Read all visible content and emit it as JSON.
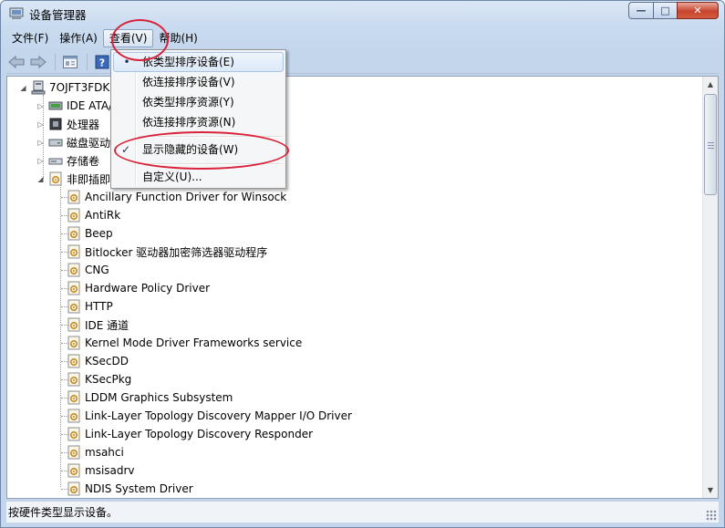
{
  "window": {
    "title": "设备管理器",
    "min_label": "—",
    "max_label": "□",
    "close_label": "✕"
  },
  "menubar": {
    "items": [
      "文件(F)",
      "操作(A)",
      "查看(V)",
      "帮助(H)"
    ],
    "active_index": 2
  },
  "toolbar": {
    "icons": [
      "back-arrow-icon",
      "forward-arrow-icon",
      "properties-icon",
      "help-icon"
    ]
  },
  "tree": {
    "root": "7OJFT3FDKI",
    "categories": [
      {
        "label": "IDE ATA/",
        "icon": "ide-controller-icon"
      },
      {
        "label": "处理器",
        "icon": "processor-icon"
      },
      {
        "label": "磁盘驱动",
        "icon": "disk-drive-icon"
      },
      {
        "label": "存储卷",
        "icon": "storage-volume-icon"
      },
      {
        "label": "非即插即",
        "icon": "non-pnp-driver-icon",
        "expanded": true
      }
    ],
    "children": [
      "Ancillary Function Driver for Winsock",
      "AntiRk",
      "Beep",
      "Bitlocker 驱动器加密筛选器驱动程序",
      "CNG",
      "Hardware Policy Driver",
      "HTTP",
      "IDE 通道",
      "Kernel Mode Driver Frameworks service",
      "KSecDD",
      "KSecPkg",
      "LDDM Graphics Subsystem",
      "Link-Layer Topology Discovery Mapper I/O Driver",
      "Link-Layer Topology Discovery Responder",
      "msahci",
      "msisadrv",
      "NDIS System Driver"
    ]
  },
  "view_menu": {
    "items": [
      {
        "label": "依类型排序设备(E)",
        "mark": "•",
        "hover": true
      },
      {
        "label": "依连接排序设备(V)",
        "mark": ""
      },
      {
        "label": "依类型排序资源(Y)",
        "mark": ""
      },
      {
        "label": "依连接排序资源(N)",
        "mark": ""
      },
      {
        "label": "显示隐藏的设备(W)",
        "mark": "✓"
      },
      {
        "label": "自定义(U)...",
        "mark": ""
      }
    ]
  },
  "statusbar": {
    "text": "按硬件类型显示设备。"
  },
  "colors": {
    "annotation": "#d8233a",
    "selection": "#dce9f8"
  }
}
